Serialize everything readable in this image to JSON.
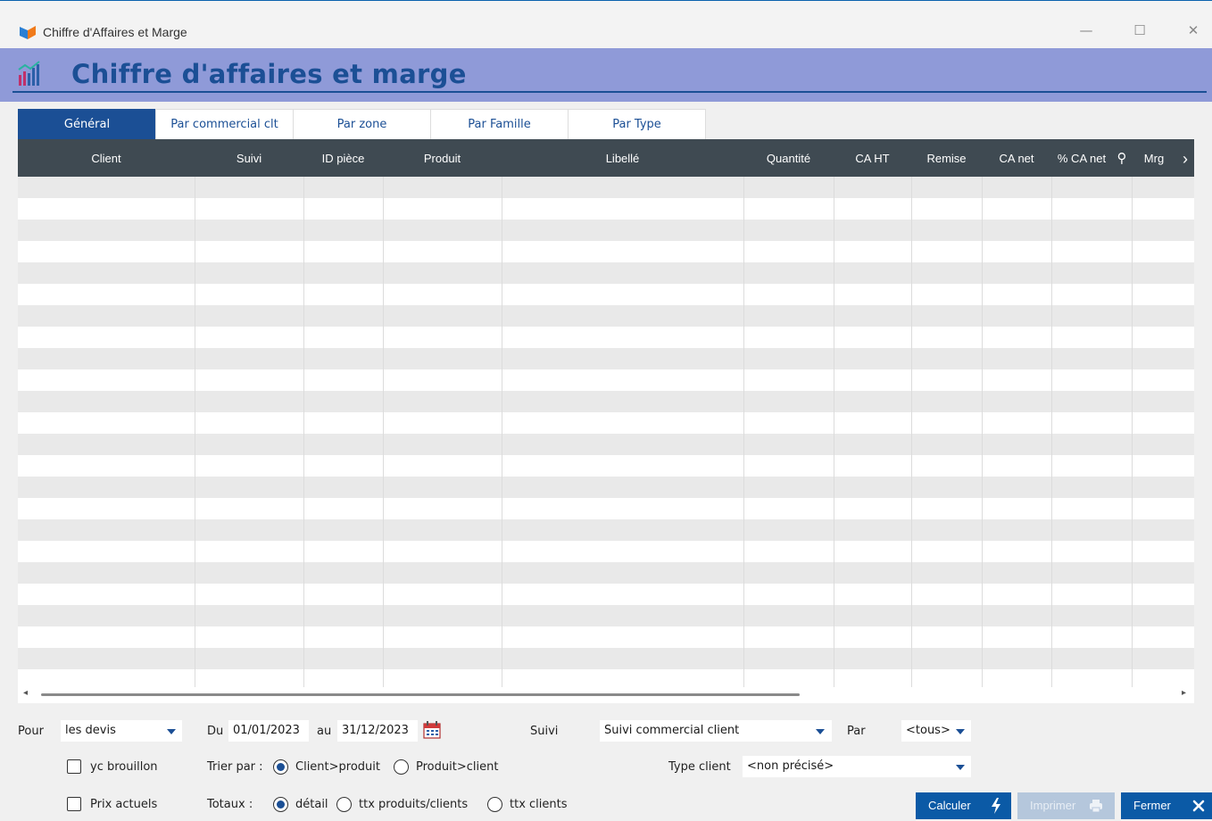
{
  "window": {
    "title": "Chiffre d'Affaires et Marge",
    "minimize_glyph": "—",
    "maximize_glyph": "☐",
    "close_glyph": "✕"
  },
  "banner": {
    "title": "Chiffre d'affaires et marge",
    "icon": "chart-bars-icon"
  },
  "tabs": [
    {
      "label": "Général",
      "active": true
    },
    {
      "label": "Par commercial clt",
      "active": false
    },
    {
      "label": "Par zone",
      "active": false
    },
    {
      "label": "Par Famille",
      "active": false
    },
    {
      "label": "Par Type",
      "active": false
    }
  ],
  "grid": {
    "columns": [
      "Client",
      "Suivi",
      "ID pièce",
      "Produit",
      "Libellé",
      "Quantité",
      "CA HT",
      "Remise",
      "CA net",
      "% CA net",
      "Mrg"
    ],
    "search_glyph": "⚲",
    "more_glyph": "›",
    "rows": []
  },
  "scroll": {
    "left_glyph": "◂",
    "right_glyph": "▸"
  },
  "filters": {
    "pour_label": "Pour",
    "pour_value": "les devis",
    "du_label": "Du",
    "date_from": "01/01/2023",
    "au_label": "au",
    "date_to": "31/12/2023",
    "suivi_label": "Suivi",
    "suivi_value": "Suivi commercial client",
    "par_label": "Par",
    "par_value": "<tous>",
    "yc_brouillon_label": "yc brouillon",
    "prix_actuels_label": "Prix actuels",
    "trier_label": "Trier par :",
    "sort_options": [
      {
        "label": "Client>produit",
        "selected": true
      },
      {
        "label": "Produit>client",
        "selected": false
      }
    ],
    "type_client_label": "Type client",
    "type_client_value": "<non précisé>",
    "totaux_label": "Totaux :",
    "totaux_options": [
      {
        "label": "détail",
        "selected": true
      },
      {
        "label": "ttx produits/clients",
        "selected": false
      },
      {
        "label": "ttx clients",
        "selected": false
      }
    ]
  },
  "buttons": {
    "calculer": "Calculer",
    "imprimer": "Imprimer",
    "fermer": "Fermer",
    "calculer_icon": "lightning-icon",
    "imprimer_icon": "printer-icon",
    "fermer_icon": "close-icon"
  },
  "colors": {
    "accent": "#1b4f95",
    "banner": "#8f9ad8",
    "header": "#3f4a52",
    "button": "#0b5aa6"
  }
}
